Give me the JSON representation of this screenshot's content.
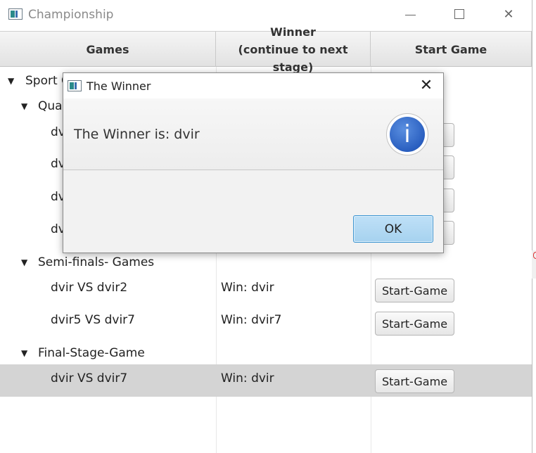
{
  "window": {
    "title": "Championship",
    "controls": {
      "minimize": "minimize-icon",
      "maximize": "maximize-icon",
      "close": "close-icon"
    }
  },
  "table": {
    "columns": {
      "games": "Games",
      "winner_line1": "Winner",
      "winner_line2": "(continue to next stage)",
      "start": "Start Game"
    },
    "root_label": "Sport Championship",
    "root_visible": "Sport C",
    "quarter_visible": "Quar",
    "quarter_games_visible": [
      "dv",
      "dv",
      "dv",
      "dv"
    ],
    "quarter_button_fragment": "e",
    "semi": {
      "label": "Semi-finals- Games",
      "games": [
        {
          "game": "dvir VS dvir2",
          "winner": "Win: dvir",
          "button": "Start-Game"
        },
        {
          "game": "dvir5 VS dvir7",
          "winner": "Win: dvir7",
          "button": "Start-Game"
        }
      ]
    },
    "final": {
      "label": "Final-Stage-Game",
      "games": [
        {
          "game": "dvir VS dvir7",
          "winner": "Win: dvir",
          "button": "Start-Game"
        }
      ]
    }
  },
  "dialog": {
    "title": "The Winner",
    "message": "The Winner is:  dvir",
    "ok": "OK",
    "close_glyph": "✕",
    "info_glyph": "i"
  }
}
